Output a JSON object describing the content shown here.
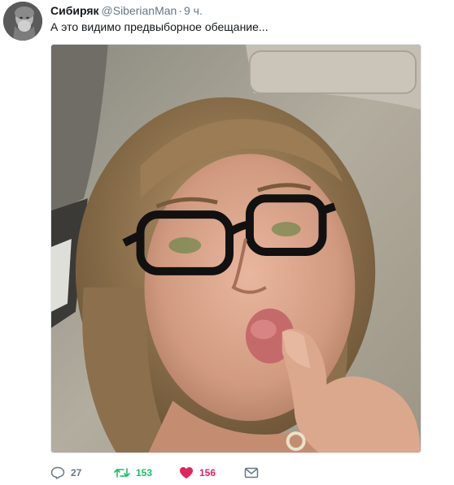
{
  "tweet": {
    "author": {
      "display_name": "Сибиряк",
      "handle": "@SiberianMan",
      "avatar_icon": "user-avatar"
    },
    "separator": "·",
    "time": "9 ч.",
    "text": "А это видимо предвыборное обещание...",
    "media": {
      "type": "photo",
      "icon": "photo-image"
    },
    "actions": {
      "reply": {
        "icon": "reply-icon",
        "count": "27"
      },
      "retweet": {
        "icon": "retweet-icon",
        "count": "153"
      },
      "like": {
        "icon": "heart-icon",
        "count": "156"
      },
      "dm": {
        "icon": "envelope-icon"
      }
    },
    "colors": {
      "text": "#14171a",
      "secondary": "#657786",
      "retweet_active": "#17bf63",
      "like_active": "#e0245e"
    }
  }
}
